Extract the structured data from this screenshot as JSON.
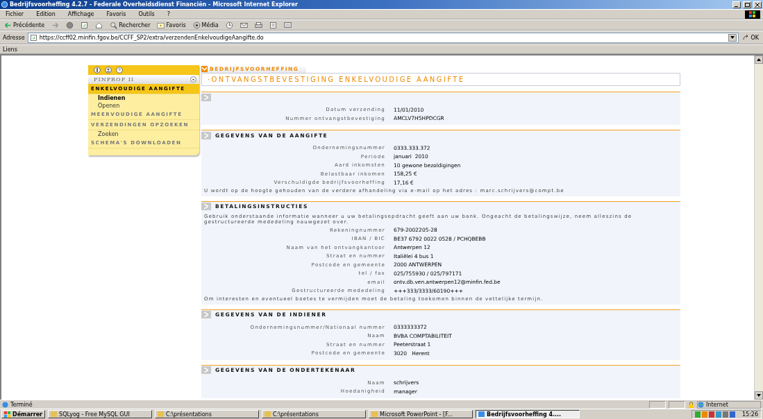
{
  "window": {
    "title": "Bedrijfsvoorheffing 4.2.7 - Federale Overheidsdienst Financiën - Microsoft Internet Explorer"
  },
  "menu": [
    "Fichier",
    "Edition",
    "Affichage",
    "Favoris",
    "Outils",
    "?"
  ],
  "toolbar": [
    {
      "kind": "back",
      "label": "Précédente"
    },
    {
      "kind": "forward"
    },
    {
      "kind": "stop"
    },
    {
      "kind": "refresh"
    },
    {
      "kind": "home"
    },
    {
      "kind": "search",
      "label": "Rechercher"
    },
    {
      "kind": "favorites",
      "label": "Favoris"
    },
    {
      "kind": "media",
      "label": "Média"
    },
    {
      "kind": "history"
    },
    {
      "kind": "mail"
    },
    {
      "kind": "print"
    },
    {
      "kind": "edit"
    },
    {
      "kind": "discuss"
    }
  ],
  "address_bar": {
    "label": "Adresse",
    "value": "https://ccff02.minfin.fgov.be/CCFF_SP2/extra/verzendenEnkelvoudigeAangifte.do",
    "go": "OK"
  },
  "links_bar": {
    "label": "Liens"
  },
  "sidebar": {
    "app_name": "FINPROF II",
    "sections": [
      {
        "label": "ENKELVOUDIGE AANGIFTE",
        "selected": true,
        "items": [
          {
            "label": "Indienen",
            "selected": true
          },
          {
            "label": "Openen",
            "selected": false
          }
        ]
      },
      {
        "label": "MEERVOUDIGE AANGIFTE",
        "selected": false
      },
      {
        "label": "VERZENDINGEN OPZOEKEN",
        "selected": false,
        "items": [
          {
            "label": "Zoeken",
            "selected": false
          }
        ]
      },
      {
        "label": "SCHEMA'S DOWNLOADEN",
        "selected": false
      }
    ]
  },
  "page": {
    "tab": "BEDRIJFSVOORHEFFING",
    "title": "·ONTVANGSTBEVESTIGING ENKELVOUDIGE AANGIFTE",
    "sections": [
      {
        "rows": [
          {
            "label": "Datum verzending",
            "value": "11/01/2010"
          },
          {
            "label": "Nummer ontvangstbevestiging",
            "value": "AMCLV7H5HPDCGR"
          }
        ]
      },
      {
        "heading": "GEGEVENS VAN DE AANGIFTE",
        "rows": [
          {
            "label": "Ondernemingsnummer",
            "value": "0333.333.372"
          },
          {
            "label": "Periode",
            "value": "januari  2010"
          },
          {
            "label": "Aard inkomsten",
            "value": "10 gewone bezoldigingen"
          },
          {
            "label": "Belastbaar inkomen",
            "value": "158,25 €"
          },
          {
            "label": "Verschuldigde bedrijfsvoorheffing",
            "value": "17,16 €"
          }
        ],
        "note": "U wordt op de hoogte gehouden van de verdere afhandeling via e-mail op het adres : marc.schrijvers@compt.be"
      },
      {
        "heading": "BETALINGSINSTRUCTIES",
        "intro": "Gebruik onderstaande informatie wanneer u uw betalingsopdracht geeft aan uw bank. Ongeacht de betalingswijze, neem alleszins de gestructureerde mededeling nauwgezet over.",
        "rows": [
          {
            "label": "Rekeningnummer",
            "value": "679-2002205-28"
          },
          {
            "label": "IBAN / BIC",
            "value": "BE37 6792 0022 0528 / PCHQBEBB"
          },
          {
            "label": "Naam van het ontvangkantoor",
            "value": "Antwerpen 12"
          },
          {
            "label": "Straat en nummer",
            "value": "Italiëlei 4 bus 1"
          },
          {
            "label": "Postcode en gemeente",
            "value": "2000 ANTWERPEN"
          },
          {
            "label": "tel / fax",
            "value": "025/755930 / 025/797171"
          },
          {
            "label": "email",
            "value": "ontv.db.ven.antwerpen12@minfin.fed.be"
          },
          {
            "label": "Gestructureerde mededeling",
            "value": "+++333/3333/60190+++"
          }
        ],
        "note": "Om interesten en eventueel boetes te vermijden moet de betaling toekomen binnen de vettelijke termijn."
      },
      {
        "heading": "GEGEVENS VAN DE INDIENER",
        "rows": [
          {
            "label": "Ondernemingsnummer/Nationaal nummer",
            "value": "0333333372"
          },
          {
            "label": "Naam",
            "value": "BVBA COMPTABILITEIT"
          },
          {
            "label": "Straat en nummer",
            "value": "Peeterstraat 1"
          },
          {
            "label": "Postcode en gemeente",
            "value": "3020   Herent"
          }
        ]
      },
      {
        "heading": "GEGEVENS VAN DE ONDERTEKENAAR",
        "rows": [
          {
            "label": "Naam",
            "value": "schrijvers"
          },
          {
            "label": "Hoedanigheid",
            "value": "manager"
          }
        ]
      }
    ]
  },
  "status_bar": {
    "text": "Terminé",
    "zone": "Internet"
  },
  "taskbar": {
    "start": "Démarrer",
    "tasks": [
      {
        "label": "SQLyog - Free MySQL GUI",
        "selected": false
      },
      {
        "label": "C:\\présentations",
        "selected": false
      },
      {
        "label": "C:\\présentations",
        "selected": false
      },
      {
        "label": "Microsoft PowerPoint - [F...",
        "selected": false
      },
      {
        "label": "Bedrijfsvoorheffing 4....",
        "selected": true
      }
    ],
    "clock": "15:26"
  }
}
